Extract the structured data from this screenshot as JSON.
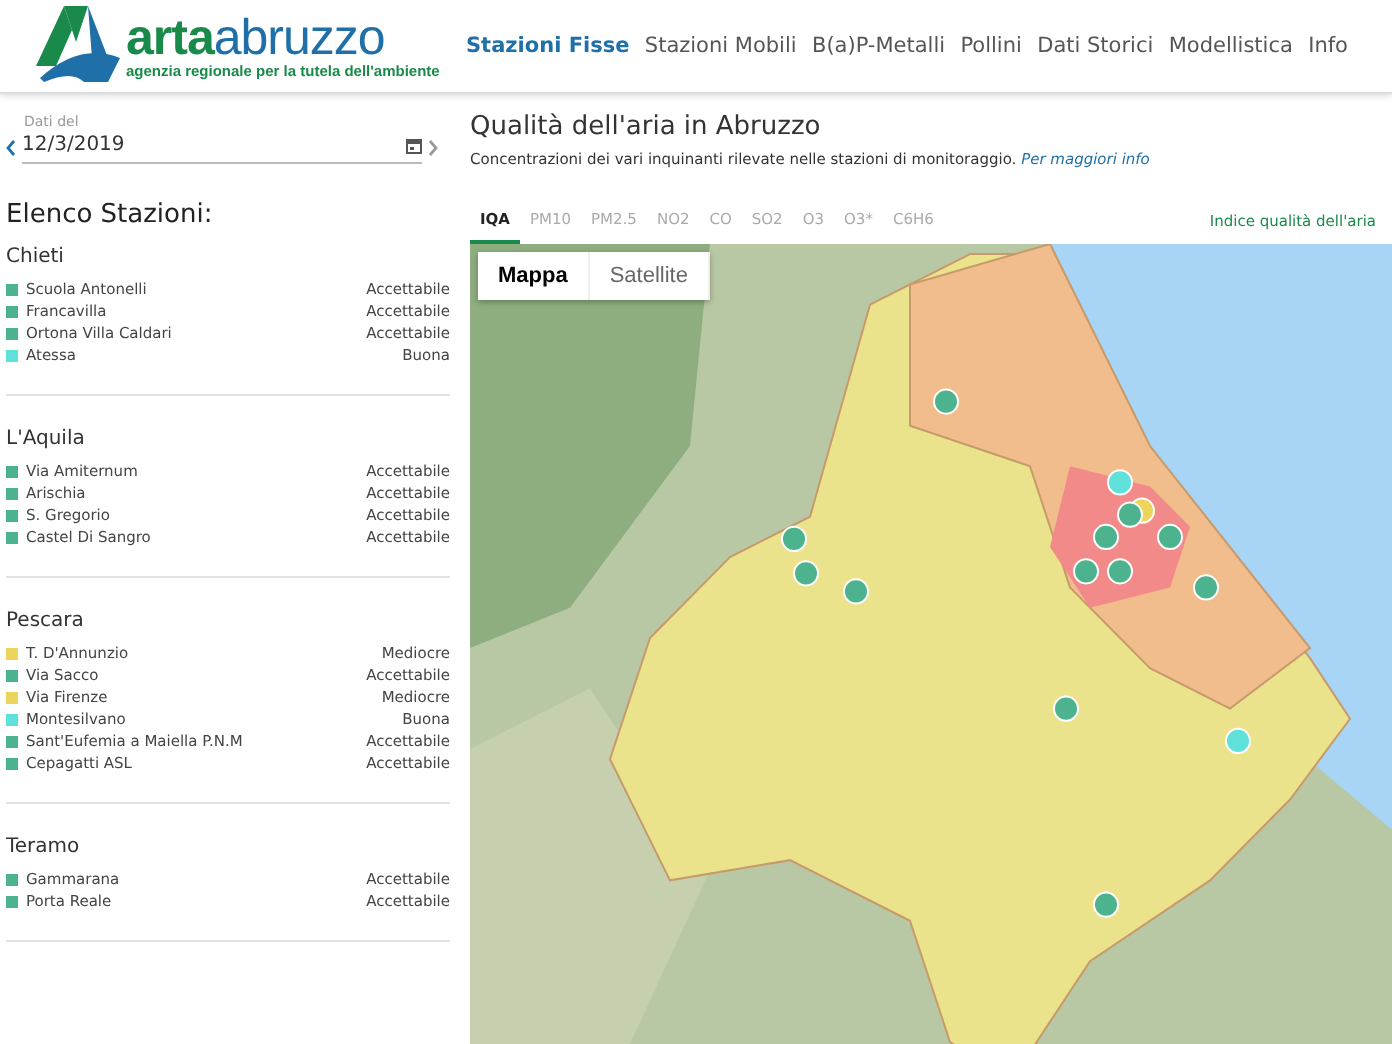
{
  "logo": {
    "name_bold": "arta",
    "name_light": "abruzzo",
    "tagline": "agenzia regionale per la tutela dell'ambiente"
  },
  "nav": [
    {
      "label": "Stazioni Fisse",
      "selected": true
    },
    {
      "label": "Stazioni Mobili",
      "selected": false
    },
    {
      "label": "B(a)P-Metalli",
      "selected": false
    },
    {
      "label": "Pollini",
      "selected": false
    },
    {
      "label": "Dati Storici",
      "selected": false
    },
    {
      "label": "Modellistica",
      "selected": false
    },
    {
      "label": "Info",
      "selected": false
    }
  ],
  "date": {
    "label": "Dati del",
    "value": "12/3/2019"
  },
  "sidebar": {
    "title": "Elenco Stazioni:",
    "groups": [
      {
        "name": "Chieti",
        "stations": [
          {
            "name": "Scuola Antonelli",
            "quality": "Accettabile",
            "color": "#4cb38e"
          },
          {
            "name": "Francavilla",
            "quality": "Accettabile",
            "color": "#4cb38e"
          },
          {
            "name": "Ortona Villa Caldari",
            "quality": "Accettabile",
            "color": "#4cb38e"
          },
          {
            "name": "Atessa",
            "quality": "Buona",
            "color": "#5fe0d9"
          }
        ]
      },
      {
        "name": "L'Aquila",
        "stations": [
          {
            "name": "Via Amiternum",
            "quality": "Accettabile",
            "color": "#4cb38e"
          },
          {
            "name": "Arischia",
            "quality": "Accettabile",
            "color": "#4cb38e"
          },
          {
            "name": "S. Gregorio",
            "quality": "Accettabile",
            "color": "#4cb38e"
          },
          {
            "name": "Castel Di Sangro",
            "quality": "Accettabile",
            "color": "#4cb38e"
          }
        ]
      },
      {
        "name": "Pescara",
        "stations": [
          {
            "name": "T. D'Annunzio",
            "quality": "Mediocre",
            "color": "#ecd55a"
          },
          {
            "name": "Via Sacco",
            "quality": "Accettabile",
            "color": "#4cb38e"
          },
          {
            "name": "Via Firenze",
            "quality": "Mediocre",
            "color": "#ecd55a"
          },
          {
            "name": "Montesilvano",
            "quality": "Buona",
            "color": "#5fe0d9"
          },
          {
            "name": "Sant'Eufemia a Maiella P.N.M",
            "quality": "Accettabile",
            "color": "#4cb38e"
          },
          {
            "name": "Cepagatti ASL",
            "quality": "Accettabile",
            "color": "#4cb38e"
          }
        ]
      },
      {
        "name": "Teramo",
        "stations": [
          {
            "name": "Gammarana",
            "quality": "Accettabile",
            "color": "#4cb38e"
          },
          {
            "name": "Porta Reale",
            "quality": "Accettabile",
            "color": "#4cb38e"
          }
        ]
      }
    ]
  },
  "main": {
    "title": "Qualità dell'aria in Abruzzo",
    "subtitle": "Concentrazioni dei vari inquinanti rilevate nelle stazioni di monitoraggio.",
    "info_link": "Per maggiori info",
    "tabs": [
      {
        "label": "IQA",
        "selected": true
      },
      {
        "label": "PM10",
        "selected": false
      },
      {
        "label": "PM2.5",
        "selected": false
      },
      {
        "label": "NO2",
        "selected": false
      },
      {
        "label": "CO",
        "selected": false
      },
      {
        "label": "SO2",
        "selected": false
      },
      {
        "label": "O3",
        "selected": false
      },
      {
        "label": "O3*",
        "selected": false
      },
      {
        "label": "C6H6",
        "selected": false
      }
    ],
    "index_label": "Indice qualità dell'aria",
    "map_types": [
      {
        "label": "Mappa",
        "selected": true
      },
      {
        "label": "Satellite",
        "selected": false
      }
    ]
  }
}
